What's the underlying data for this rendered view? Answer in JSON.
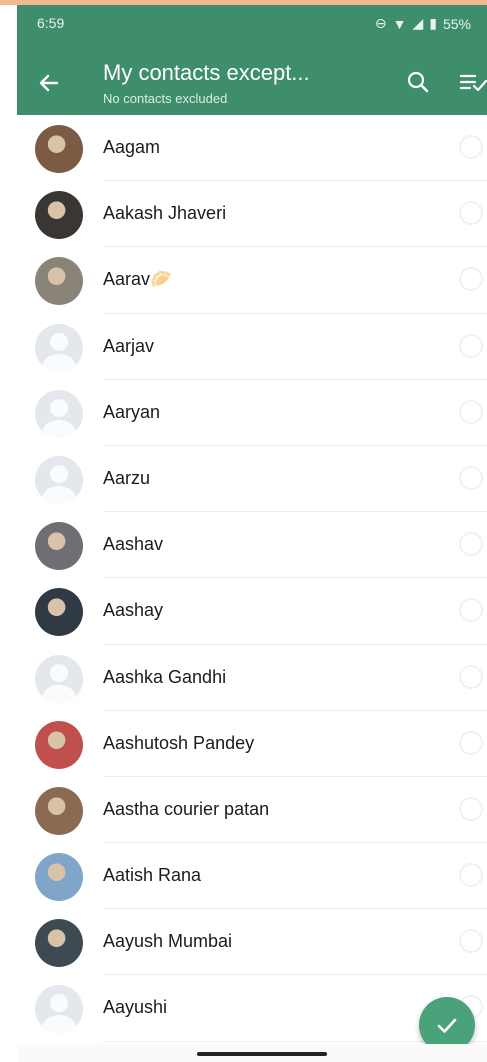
{
  "status_bar": {
    "time": "6:59",
    "battery": "55%"
  },
  "header": {
    "title": "My contacts except...",
    "subtitle": "No contacts excluded",
    "back_icon": "arrow-left-icon",
    "search_icon": "search-icon",
    "select_all_icon": "select-all-icon"
  },
  "contacts": [
    {
      "name": "Aagam",
      "avatar": "photo",
      "color": "#7c5a44"
    },
    {
      "name": "Aakash Jhaveri",
      "avatar": "photo",
      "color": "#3a3634"
    },
    {
      "name": "Aarav🥟",
      "avatar": "photo",
      "color": "#8a8478"
    },
    {
      "name": "Aarjav",
      "avatar": "default"
    },
    {
      "name": "Aaryan",
      "avatar": "default"
    },
    {
      "name": "Aarzu",
      "avatar": "default"
    },
    {
      "name": "Aashav",
      "avatar": "photo",
      "color": "#6f6e73"
    },
    {
      "name": "Aashay",
      "avatar": "photo",
      "color": "#2f3a44"
    },
    {
      "name": "Aashka Gandhi",
      "avatar": "default"
    },
    {
      "name": "Aashutosh Pandey",
      "avatar": "photo",
      "color": "#c0504d"
    },
    {
      "name": "Aastha courier patan",
      "avatar": "photo",
      "color": "#8c6a52"
    },
    {
      "name": "Aatish Rana",
      "avatar": "photo",
      "color": "#7fa6c9"
    },
    {
      "name": "Aayush Mumbai",
      "avatar": "photo",
      "color": "#3e4a52"
    },
    {
      "name": "Aayushi",
      "avatar": "default"
    }
  ],
  "fab": {
    "icon": "checkmark-icon"
  },
  "colors": {
    "app_bar": "#3e8e6c",
    "fab": "#4aa27a"
  }
}
